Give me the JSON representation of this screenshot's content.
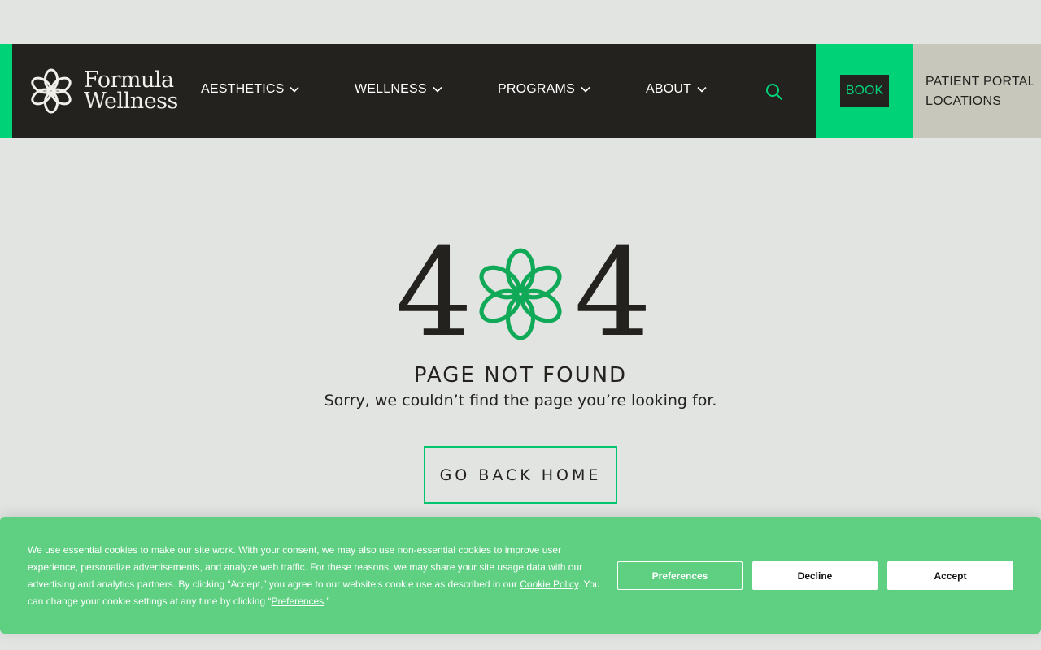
{
  "colors": {
    "accent": "#00d278",
    "dark": "#24221f",
    "background": "#e2e4e1",
    "cookie_bg": "#5fcf82",
    "portal_bg": "#c7c8bb"
  },
  "header": {
    "logo": {
      "line1": "Formula",
      "line2": "Wellness"
    },
    "nav": [
      {
        "label": "AESTHETICS",
        "icon": "chevron-down-icon"
      },
      {
        "label": "WELLNESS",
        "icon": "chevron-down-icon"
      },
      {
        "label": "PROGRAMS",
        "icon": "chevron-down-icon"
      },
      {
        "label": "ABOUT",
        "icon": "chevron-down-icon"
      }
    ],
    "search_icon": "search-icon",
    "book_label": "BOOK",
    "portal_label": "PATIENT PORTAL",
    "locations_label": "LOCATIONS"
  },
  "error": {
    "digit_left": "4",
    "digit_right": "4",
    "knot_icon": "knot-logo-icon",
    "title": "PAGE NOT FOUND",
    "subtitle": "Sorry, we couldn’t find the page you’re looking for.",
    "home_button": "GO BACK HOME"
  },
  "cookie": {
    "text_part1": "We use essential cookies to make our site work. With your consent, we may also use non-essential cookies to improve user experience, personalize advertisements, and analyze web traffic. For these reasons, we may share your site usage data with our advertising and analytics partners. By clicking “Accept,” you agree to our website's cookie use as described in our ",
    "policy_link": "Cookie Policy",
    "text_part2": ". You can change your cookie settings at any time by clicking “",
    "preferences_link": "Preferences",
    "text_part3": ".”",
    "buttons": {
      "preferences": "Preferences",
      "decline": "Decline",
      "accept": "Accept"
    }
  }
}
